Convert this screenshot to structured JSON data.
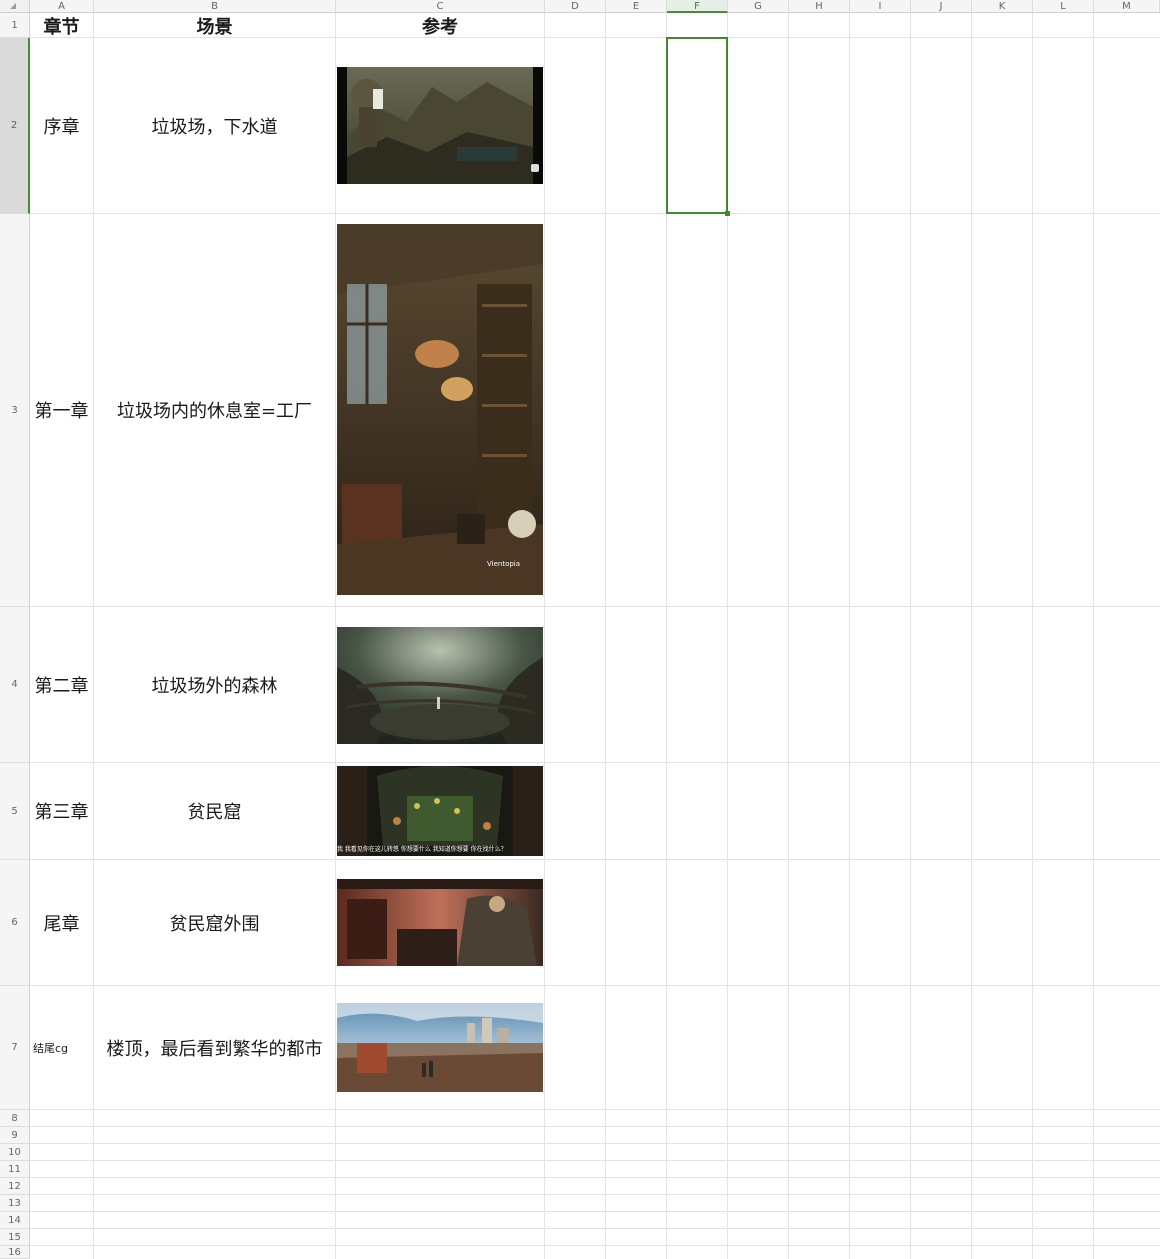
{
  "columns": [
    "A",
    "B",
    "C",
    "D",
    "E",
    "F",
    "G",
    "H",
    "I",
    "J",
    "K",
    "L",
    "M"
  ],
  "rows": [
    "1",
    "2",
    "3",
    "4",
    "5",
    "6",
    "7",
    "8",
    "9",
    "10",
    "11",
    "12",
    "13",
    "14",
    "15",
    "16"
  ],
  "selected_cell": {
    "column": "F",
    "row": "2"
  },
  "header": {
    "chapter": "章节",
    "scene": "场景",
    "reference": "参考"
  },
  "chapters": [
    {
      "chapter": "序章",
      "scene": "垃圾场，下水道",
      "image": "junkyard-sewer-scene"
    },
    {
      "chapter": "第一章",
      "scene": "垃圾场内的休息室=工厂",
      "image": "steampunk-workshop-scene",
      "watermark": "Vientopia"
    },
    {
      "chapter": "第二章",
      "scene": "垃圾场外的森林",
      "image": "forest-roots-scene"
    },
    {
      "chapter": "第三章",
      "scene": "贫民窟",
      "image": "slum-interior-scene",
      "caption": "我 我看见你在这儿转悠 你想要什么 我知道你想要 你在找什么？"
    },
    {
      "chapter": "尾章",
      "scene": "贫民窟外围",
      "image": "slum-outskirts-scene"
    },
    {
      "chapter": "结尾cg",
      "scene": "楼顶，最后看到繁华的都市",
      "image": "rooftop-city-scene"
    }
  ],
  "colors": {
    "selection": "#3f8a2e",
    "header_bg": "#f5f5f5",
    "grid": "#e2e2e2"
  }
}
